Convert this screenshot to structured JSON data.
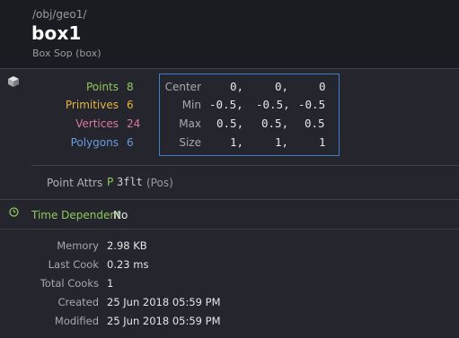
{
  "header": {
    "path": "/obj/geo1/",
    "title": "box1",
    "subtitle": "Box Sop (box)"
  },
  "counts": [
    {
      "label": "Points",
      "value": "8",
      "color": "#8fc95c"
    },
    {
      "label": "Primitives",
      "value": "6",
      "color": "#e8b640"
    },
    {
      "label": "Vertices",
      "value": "24",
      "color": "#d87aa0"
    },
    {
      "label": "Polygons",
      "value": "6",
      "color": "#6a9ae0"
    }
  ],
  "bbox": {
    "rows": [
      {
        "label": "Center",
        "x": "0,",
        "y": "0,",
        "z": "0"
      },
      {
        "label": "Min",
        "x": "-0.5,",
        "y": "-0.5,",
        "z": "-0.5"
      },
      {
        "label": "Max",
        "x": "0.5,",
        "y": "0.5,",
        "z": "0.5"
      },
      {
        "label": "Size",
        "x": "1,",
        "y": "1,",
        "z": "1"
      }
    ]
  },
  "attributes": {
    "label": "Point Attrs",
    "class_letter": "P",
    "type": "3flt",
    "name": "(Pos)"
  },
  "time_dependent": {
    "label": "Time Dependent",
    "value": "No"
  },
  "info": [
    {
      "label": "Memory",
      "value": "2.98 KB"
    },
    {
      "label": "Last Cook",
      "value": "0.23 ms"
    },
    {
      "label": "Total Cooks",
      "value": "1"
    },
    {
      "label": "Created",
      "value": "25 Jun 2018 05:59 PM"
    },
    {
      "label": "Modified",
      "value": "25 Jun 2018 05:59 PM"
    }
  ],
  "icons": {
    "geometry": "box-icon",
    "time": "clock-icon"
  }
}
